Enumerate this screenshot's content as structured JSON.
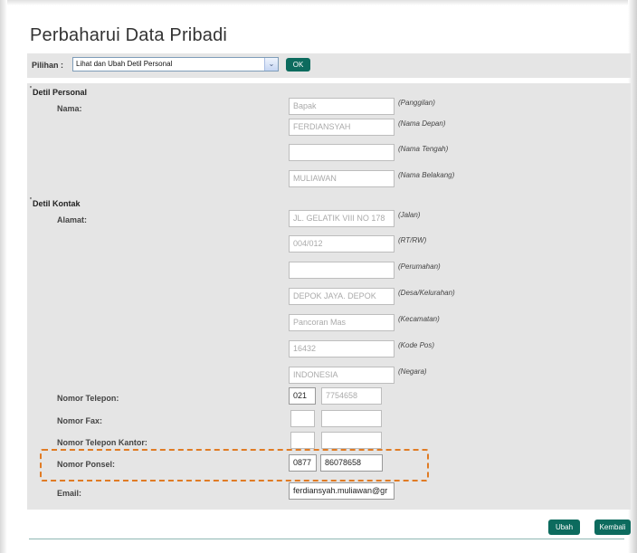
{
  "page": {
    "title": "Perbaharui Data Pribadi"
  },
  "pilihan": {
    "label": "Pilihan :",
    "selected": "Lihat dan Ubah Detil Personal",
    "dropdown_glyph": "⌄",
    "ok_label": "OK"
  },
  "personal": {
    "section_title": "Detil Personal",
    "nama_label": "Nama:",
    "fields": [
      {
        "value": "Bapak",
        "hint": "(Panggilan)"
      },
      {
        "value": "FERDIANSYAH",
        "hint": "(Nama Depan)"
      },
      {
        "value": "",
        "hint": "(Nama Tengah)"
      },
      {
        "value": "MULIAWAN",
        "hint": "(Nama Belakang)"
      }
    ]
  },
  "kontak": {
    "section_title": "Detil Kontak",
    "alamat_label": "Alamat:",
    "alamat_fields": [
      {
        "value": "JL. GELATIK VIII NO 178",
        "hint": "(Jalan)"
      },
      {
        "value": "004/012",
        "hint": "(RT/RW)"
      },
      {
        "value": "",
        "hint": "(Perumahan)"
      },
      {
        "value": "DEPOK JAYA. DEPOK",
        "hint": "(Desa/Kelurahan)"
      },
      {
        "value": "Pancoran Mas",
        "hint": "(Kecamatan)"
      },
      {
        "value": "16432",
        "hint": "(Kode Pos)"
      },
      {
        "value": "INDONESIA",
        "hint": "(Negara)"
      }
    ],
    "telepon": {
      "label": "Nomor Telepon:",
      "code": "021",
      "number": "7754658"
    },
    "fax": {
      "label": "Nomor Fax:",
      "code": "",
      "number": ""
    },
    "kantor": {
      "label": "Nomor Telepon Kantor:",
      "code": "",
      "number": ""
    },
    "ponsel": {
      "label": "Nomor Ponsel:",
      "code": "0877",
      "number": "86078658"
    },
    "email": {
      "label": "Email:",
      "value": "ferdiansyah.muliawan@gr"
    }
  },
  "actions": {
    "ubah": "Ubah",
    "kembali": "Kembali"
  },
  "colors": {
    "button": "#0c6b5e",
    "highlight": "#e07b24",
    "panel": "#e5e5e5"
  }
}
